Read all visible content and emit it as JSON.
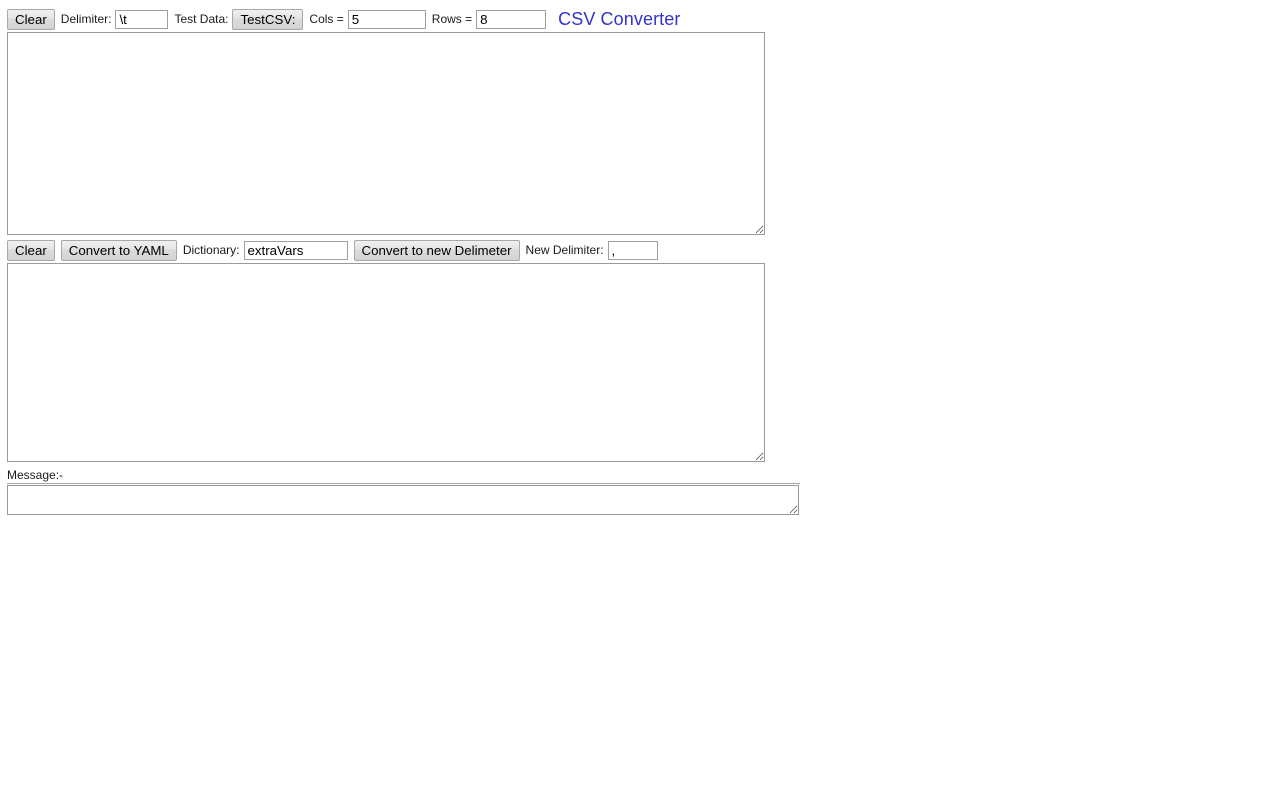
{
  "app": {
    "title": "CSV Converter"
  },
  "toolbar_top": {
    "clear_label": "Clear",
    "delimiter_label": "Delimiter:",
    "delimiter_value": "\\t",
    "test_data_label": "Test Data:",
    "test_csv_label": "TestCSV:",
    "cols_label": "Cols =",
    "cols_value": "5",
    "rows_label": "Rows =",
    "rows_value": "8"
  },
  "input_area": {
    "value": "",
    "placeholder": ""
  },
  "toolbar_middle": {
    "clear_label": "Clear",
    "convert_yaml_label": "Convert to YAML",
    "dictionary_label": "Dictionary:",
    "dictionary_value": "extraVars",
    "convert_delimiter_label": "Convert to new Delimeter",
    "new_delimiter_label": "New Delimiter:",
    "new_delimiter_value": ","
  },
  "output_area": {
    "value": "",
    "placeholder": ""
  },
  "message": {
    "label": "Message:-",
    "value": "",
    "placeholder": ""
  },
  "colors": {
    "title": "#3333cc",
    "button_border": "#a9a9a9",
    "field_border": "#a0a0a0",
    "textarea_border": "#9a9a9a",
    "page_background": "#ffffff"
  }
}
